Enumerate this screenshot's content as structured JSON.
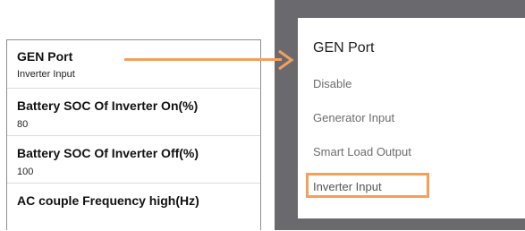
{
  "settings": {
    "items": [
      {
        "title": "GEN Port",
        "value": "Inverter Input"
      },
      {
        "title": "Battery SOC Of Inverter On(%)",
        "value": "80"
      },
      {
        "title": "Battery SOC Of Inverter Off(%)",
        "value": "100"
      },
      {
        "title": "AC couple Frequency high(Hz)",
        "value": ""
      }
    ]
  },
  "dialog": {
    "title": "GEN Port",
    "options": [
      "Disable",
      "Generator Input",
      "Smart Load Output",
      "Inverter Input"
    ],
    "selected": "Inverter Input"
  },
  "colors": {
    "annotation": "#f4a05a",
    "overlay": "#6a6a6e"
  }
}
